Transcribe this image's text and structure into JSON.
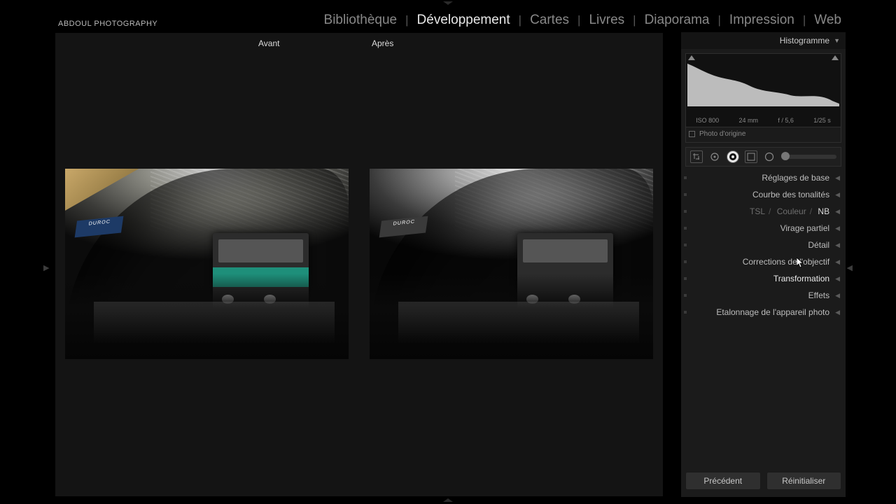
{
  "identity": "ABDOUL PHOTOGRAPHY",
  "modules": {
    "library": "Bibliothèque",
    "develop": "Développement",
    "map": "Cartes",
    "book": "Livres",
    "slideshow": "Diaporama",
    "print": "Impression",
    "web": "Web",
    "active": "develop"
  },
  "compare": {
    "before": "Avant",
    "after": "Après"
  },
  "station_sign": "DUROC",
  "histogram": {
    "title": "Histogramme",
    "meta": {
      "iso": "ISO 800",
      "focal": "24 mm",
      "aperture": "f / 5,6",
      "shutter": "1/25 s"
    },
    "original_label": "Photo d'origine"
  },
  "panels": {
    "basic": "Réglages de base",
    "tonecurve": "Courbe des tonalités",
    "hsl": {
      "tsl": "TSL",
      "color": "Couleur",
      "nb": "NB"
    },
    "split": "Virage partiel",
    "detail": "Détail",
    "lens": "Corrections de l'objectif",
    "transform": "Transformation",
    "effects": "Effets",
    "calibration": "Etalonnage de l'appareil photo"
  },
  "buttons": {
    "previous": "Précédent",
    "reset": "Réinitialiser"
  }
}
